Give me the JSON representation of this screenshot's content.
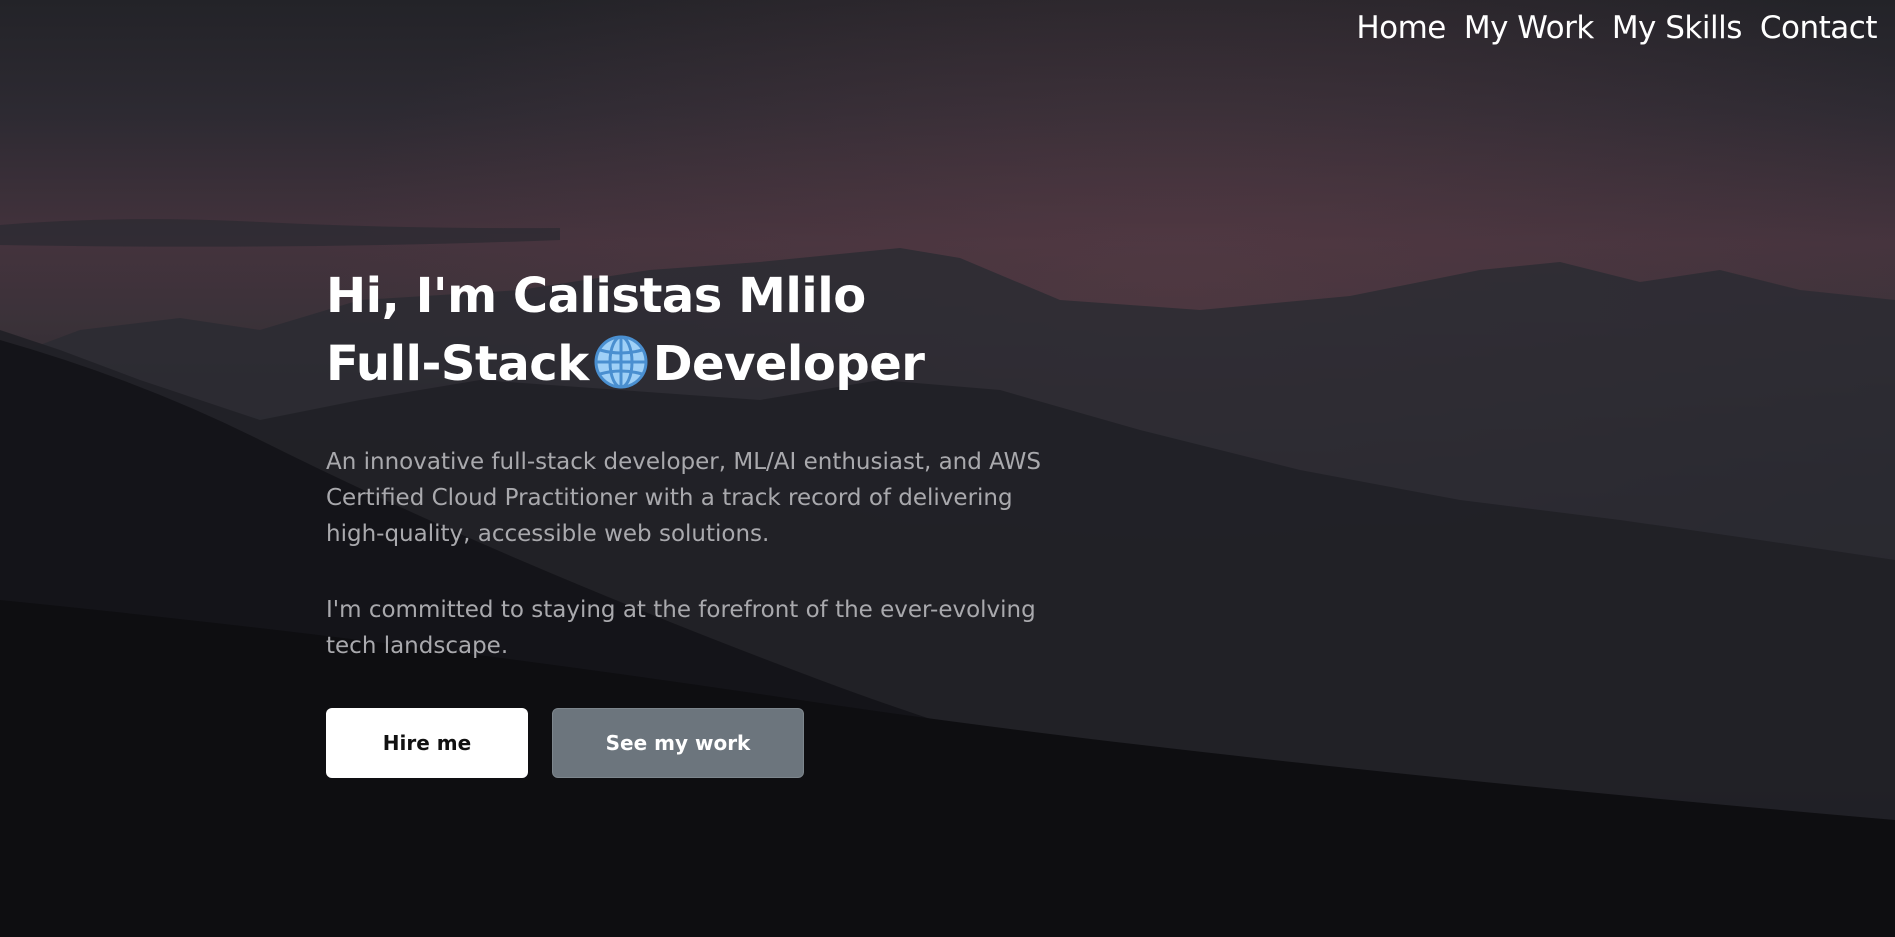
{
  "nav": {
    "items": [
      {
        "label": "Home"
      },
      {
        "label": "My Work"
      },
      {
        "label": "My Skills"
      },
      {
        "label": "Contact"
      }
    ]
  },
  "hero": {
    "title_line1": "Hi, I'm Calistas Mlilo",
    "title_line2_before": "Full-Stack",
    "title_line2_after": "Developer",
    "title_icon": "globe-icon",
    "description_1": "An innovative full-stack developer, ML/AI enthusiast, and AWS Certified Cloud Practitioner with a track record of delivering high-quality, accessible web solutions.",
    "description_2": "I'm committed to staying at the forefront of the ever-evolving tech landscape."
  },
  "buttons": {
    "hire_label": "Hire me",
    "work_label": "See my work"
  },
  "colors": {
    "primary_button_bg": "#ffffff",
    "secondary_button_bg": "#6c757d",
    "description_text": "#a9a9ad"
  }
}
